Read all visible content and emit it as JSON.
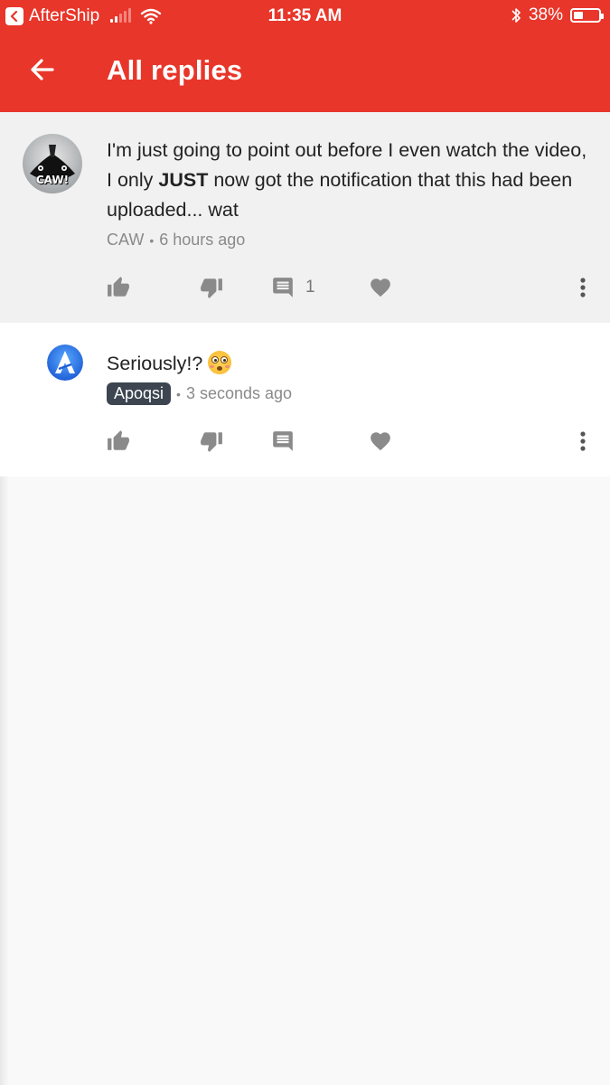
{
  "status_bar": {
    "back_app": "AfterShip",
    "time": "11:35 AM",
    "battery": "38%",
    "battery_level": 0.38
  },
  "app_bar": {
    "title": "All replies",
    "back_icon": "arrow-left-icon"
  },
  "comments": [
    {
      "avatar_label": "CAW!",
      "text_before": "I'm just going to point out before I even watch the video, I only ",
      "text_bold": "JUST",
      "text_after": " now got the notification that this had been uploaded... wat",
      "author": "CAW",
      "time": "6 hours ago",
      "reply_count": "1"
    },
    {
      "text": "Seriously!?",
      "emoji": "flushed-face",
      "author": "Apoqsi",
      "time": "3 seconds ago"
    }
  ],
  "colors": {
    "brand": "#e8362a",
    "parent_bg": "#f1f1f1",
    "reply_bg": "#ffffff",
    "page_bg": "#f9f9f9",
    "author_chip": "#3c4550"
  },
  "icons": [
    "thumb-up-icon",
    "thumb-down-icon",
    "reply-comment-icon",
    "heart-icon",
    "more-vert-icon"
  ]
}
